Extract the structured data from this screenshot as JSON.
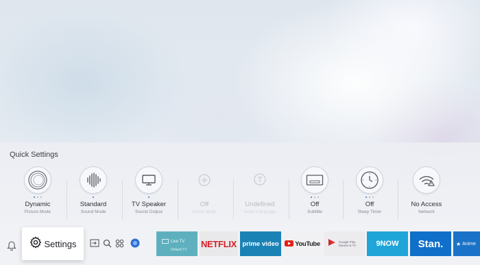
{
  "quick_settings": {
    "title": "Quick Settings",
    "items": [
      {
        "value": "Dynamic",
        "sub": "Picture Mode",
        "icon": "picture-mode-icon",
        "dots": 3,
        "active_dot": 0
      },
      {
        "value": "Standard",
        "sub": "Sound Mode",
        "icon": "sound-wave-icon",
        "dots": 1,
        "active_dot": 0
      },
      {
        "value": "TV Speaker",
        "sub": "Sound Output",
        "icon": "tv-icon",
        "dots": 1,
        "active_dot": 0
      },
      {
        "value": "Off",
        "sub": "Game Mode",
        "icon": "game-icon",
        "dots": 0,
        "active_dot": -1
      },
      {
        "value": "Undefined",
        "sub": "Audio Language",
        "icon": "audio-language-icon",
        "dots": 0,
        "active_dot": -1
      },
      {
        "value": "Off",
        "sub": "Subtitle",
        "icon": "subtitle-icon",
        "dots": 3,
        "active_dot": 0
      },
      {
        "value": "Off",
        "sub": "Sleep Timer",
        "icon": "sleep-timer-icon",
        "dots": 3,
        "active_dot": 0
      },
      {
        "value": "No Access",
        "sub": "Network",
        "icon": "network-warning-icon",
        "dots": 0,
        "active_dot": -1
      }
    ]
  },
  "bottom_bar": {
    "settings_label": "Settings",
    "apps": [
      {
        "label": "Live TV",
        "sub": "Default TV",
        "color": "#5fb0bf"
      },
      {
        "label": "NETFLIX",
        "color": "#e9e9eb"
      },
      {
        "label": "prime video",
        "color": "#1b82b6"
      },
      {
        "label": "YouTube",
        "color": "#f1f1f3"
      },
      {
        "label": "Google Play Movies & TV",
        "color": "#ececef"
      },
      {
        "label": "9NOW",
        "color": "#1fa5d8"
      },
      {
        "label": "Stan.",
        "color": "#0f6fc9"
      },
      {
        "label": "Anime",
        "color": "#1a73c8"
      }
    ]
  },
  "colors": {
    "accent": "#3a72c4",
    "panel": "#eff0f4"
  }
}
